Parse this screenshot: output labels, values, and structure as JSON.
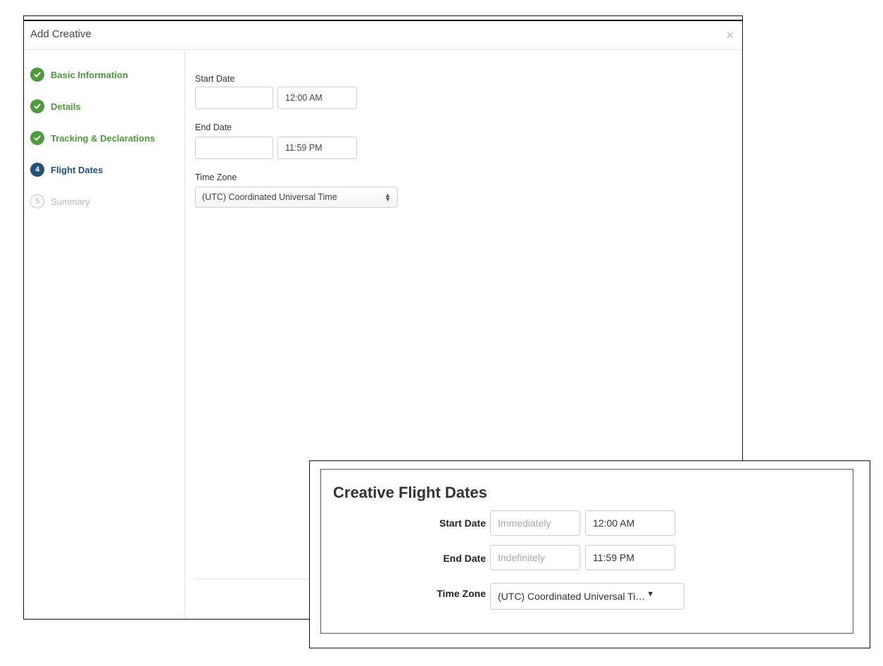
{
  "modal": {
    "title": "Add Creative",
    "close_icon": "×",
    "steps": [
      {
        "number": "✓",
        "label": "Basic Information",
        "state": "done"
      },
      {
        "number": "✓",
        "label": "Details",
        "state": "done"
      },
      {
        "number": "✓",
        "label": "Tracking & Declarations",
        "state": "done"
      },
      {
        "number": "4",
        "label": "Flight Dates",
        "state": "active"
      },
      {
        "number": "5",
        "label": "Summary",
        "state": "pending"
      }
    ],
    "form": {
      "start_date_label": "Start Date",
      "start_date_value": "",
      "start_time_value": "12:00 AM",
      "end_date_label": "End Date",
      "end_date_value": "",
      "end_time_value": "11:59 PM",
      "time_zone_label": "Time Zone",
      "time_zone_value": "(UTC) Coordinated Universal Time",
      "time_zone_arrows": "▲▼"
    }
  },
  "inset": {
    "title": "Creative Flight Dates",
    "start_date_label": "Start Date",
    "start_date_placeholder": "Immediately",
    "start_time_value": "12:00 AM",
    "end_date_label": "End Date",
    "end_date_placeholder": "Indefinitely",
    "end_time_value": "11:59 PM",
    "time_zone_label": "Time Zone",
    "time_zone_value": "(UTC) Coordinated Universal Ti…",
    "time_zone_caret": "▼"
  },
  "colors": {
    "done_green": "#4f9a3c",
    "active_blue": "#22517a",
    "pending_gray": "#b8b8b8"
  }
}
